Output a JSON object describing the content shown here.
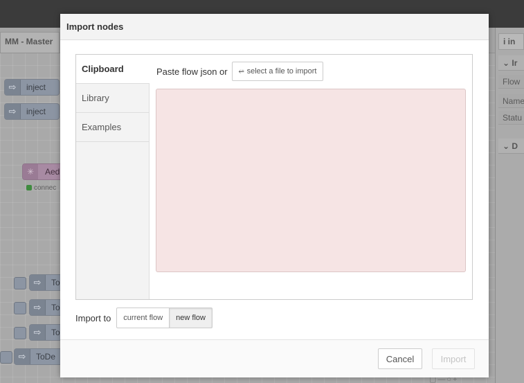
{
  "background": {
    "flow_tab_label": "MM - Master",
    "nodes": [
      {
        "label": "inject"
      },
      {
        "label": "inject"
      },
      {
        "label": "Aed"
      },
      {
        "label": "To"
      },
      {
        "label": "To"
      },
      {
        "label": "To"
      },
      {
        "label": "ToDe"
      }
    ],
    "aedes_status": "connec",
    "sidebar": {
      "header": "i  in",
      "section1": "Ir",
      "rows": [
        "Flow",
        "Name",
        "Statu"
      ],
      "section2": "D"
    }
  },
  "dialog": {
    "title": "Import nodes",
    "tabs": [
      {
        "label": "Clipboard",
        "active": true
      },
      {
        "label": "Library",
        "active": false
      },
      {
        "label": "Examples",
        "active": false
      }
    ],
    "paste_label": "Paste flow json or",
    "select_file_button": "select a file to import",
    "upload_icon": "upload-icon",
    "textarea_value": "",
    "import_to_label": "Import to",
    "import_to_options": [
      {
        "label": "current flow",
        "selected": false
      },
      {
        "label": "new flow",
        "selected": true
      }
    ],
    "cancel_button": "Cancel",
    "import_button": "Import",
    "import_enabled": false
  },
  "colors": {
    "textarea_bg": "#f6e4e4",
    "dialog_header_bg": "#f3f3f3",
    "overlay_bg": "#9d9d9d"
  }
}
